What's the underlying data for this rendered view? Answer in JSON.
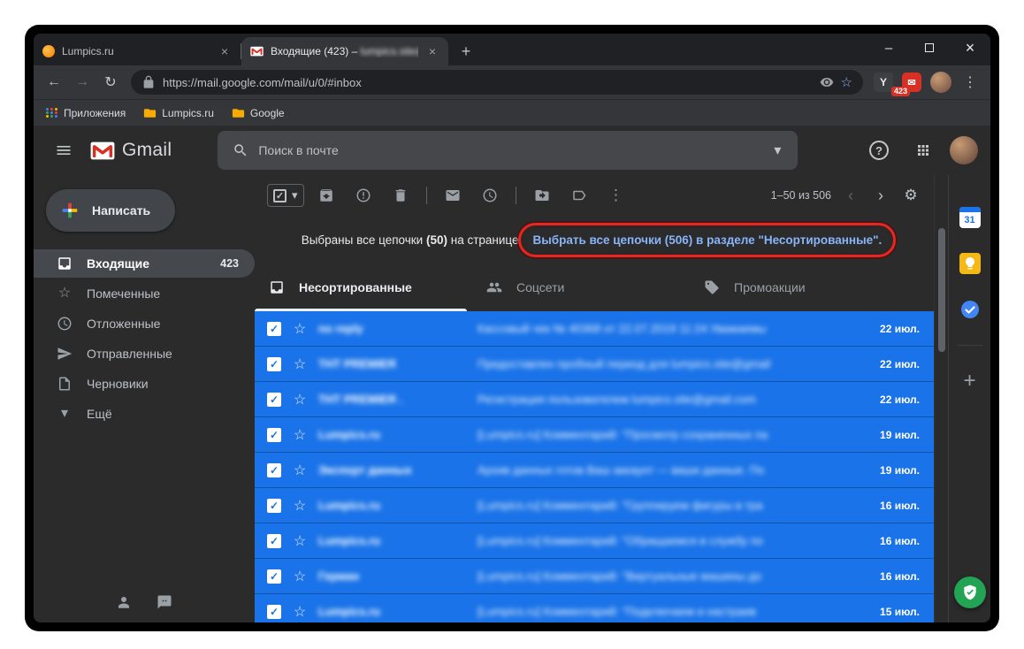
{
  "colors": {
    "selection_blue": "#1a73e8",
    "annotation_red": "#e8261f",
    "link_blue": "#8ab4f8",
    "badge_red": "#d93025",
    "folder_yellow": "#f9ab00"
  },
  "glyphs": {
    "minimize": "–",
    "close": "×",
    "back": "←",
    "forward": "→",
    "reload": "↻",
    "plus": "+",
    "star": "☆",
    "kebab": "⋮",
    "caret_down": "▾",
    "gear": "⚙",
    "chevron_left": "‹",
    "chevron_right": "›",
    "check": "✓",
    "envelope": "✉",
    "question": "?",
    "calendar_day": "31",
    "y_ext": "Y"
  },
  "browser": {
    "tabs": [
      {
        "title": "Lumpics.ru"
      },
      {
        "title_prefix": "Входящие (423) – ",
        "title_blurred": "lumpics.site@gm"
      }
    ],
    "url": "https://mail.google.com/mail/u/0/#inbox",
    "extension_badge": "423",
    "bookmarks": [
      "Приложения",
      "Lumpics.ru",
      "Google"
    ]
  },
  "gmail": {
    "logo": "Gmail",
    "search_placeholder": "Поиск в почте",
    "compose": "Написать",
    "sidebar": [
      {
        "label": "Входящие",
        "badge": "423"
      },
      {
        "label": "Помеченные"
      },
      {
        "label": "Отложенные"
      },
      {
        "label": "Отправленные"
      },
      {
        "label": "Черновики"
      },
      {
        "label": "Ещё"
      }
    ],
    "pagination": "1–50 из 506",
    "banner": {
      "pre": "Выбраны все цепочки ",
      "count": "(50)",
      "post": " на странице",
      "link": "Выбрать все цепочки (506) в разделе \"Несортированные\"."
    },
    "tabs": [
      {
        "label": "Несортированные"
      },
      {
        "label": "Соцсети"
      },
      {
        "label": "Промоакции"
      }
    ],
    "emails": [
      {
        "sender": "no reply",
        "subject": "Кассовый чек № 40368 от 22.07.2019 11:24   Уважаемы",
        "date": "22 июл."
      },
      {
        "sender": "ТНТ PREMIER",
        "subject": "Предоставлен пробный период для lumpics.site@gmail",
        "date": "22 июл."
      },
      {
        "sender": "ТНТ PREMIER .",
        "subject": "Регистрация пользователем lumpics.site@gmail.com",
        "date": "22 июл."
      },
      {
        "sender": "Lumpics.ru",
        "subject": "[Lumpics.ru] Комментарий: \"Просмотр сохраненных па",
        "date": "19 июл."
      },
      {
        "sender": "Экспорт данных",
        "subject": "Архив данных готов   Ваш аккаунт — ваши данные. По",
        "date": "19 июл."
      },
      {
        "sender": "Lumpics.ru",
        "subject": "[Lumpics.ru] Комментарий: \"Группируем фигуры в тра",
        "date": "16 июл."
      },
      {
        "sender": "Lumpics.ru",
        "subject": "[Lumpics.ru] Комментарий: \"Обращаемся в службу по",
        "date": "16 июл."
      },
      {
        "sender": "Герман",
        "subject": "[Lumpics.ru] Комментарий: \"Виртуальные машины до",
        "date": "16 июл."
      },
      {
        "sender": "Lumpics.ru",
        "subject": "[Lumpics.ru] Комментарий: \"Подключаем и настраив",
        "date": "15 июл."
      }
    ]
  }
}
